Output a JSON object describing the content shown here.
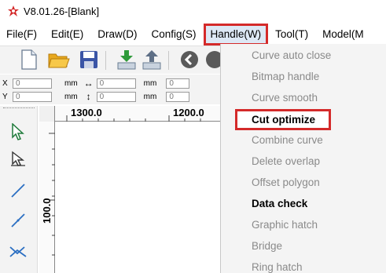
{
  "window": {
    "title": "V8.01.26-[Blank]"
  },
  "menubar": {
    "items": [
      {
        "label": "File(F)"
      },
      {
        "label": "Edit(E)"
      },
      {
        "label": "Draw(D)"
      },
      {
        "label": "Config(S)"
      },
      {
        "label": "Handle(W)"
      },
      {
        "label": "Tool(T)"
      },
      {
        "label": "Model(M"
      }
    ]
  },
  "toolbar": {
    "icons": [
      "new-file-icon",
      "open-folder-icon",
      "save-icon",
      "import-icon",
      "export-icon",
      "back-icon",
      "forward-icon"
    ]
  },
  "coords": {
    "x": {
      "label": "X",
      "value": "0",
      "unit": "mm",
      "width_value": "0",
      "width_unit": "mm",
      "extra": "0"
    },
    "y": {
      "label": "Y",
      "value": "0",
      "unit": "mm",
      "height_value": "0",
      "height_unit": "mm",
      "extra": "0"
    }
  },
  "ruler": {
    "h1": "1300.0",
    "h2": "1200.0",
    "v1": "100.0"
  },
  "handle_menu": {
    "items": [
      {
        "label": "Curve auto close",
        "enabled": false
      },
      {
        "label": "Bitmap handle",
        "enabled": false
      },
      {
        "label": "Curve smooth",
        "enabled": false
      },
      {
        "label": "Cut optimize",
        "enabled": true,
        "highlight": true
      },
      {
        "label": "Combine curve",
        "enabled": false
      },
      {
        "label": "Delete overlap",
        "enabled": false
      },
      {
        "label": "Offset polygon",
        "enabled": false
      },
      {
        "label": "Data check",
        "enabled": true
      },
      {
        "label": "Graphic hatch",
        "enabled": false
      },
      {
        "label": "Bridge",
        "enabled": false
      },
      {
        "label": "Ring hatch",
        "enabled": false
      }
    ]
  },
  "colors": {
    "highlight_border": "#d42a2a",
    "menu_active_bg": "#dde8f5",
    "logo": "#d42a2a"
  }
}
